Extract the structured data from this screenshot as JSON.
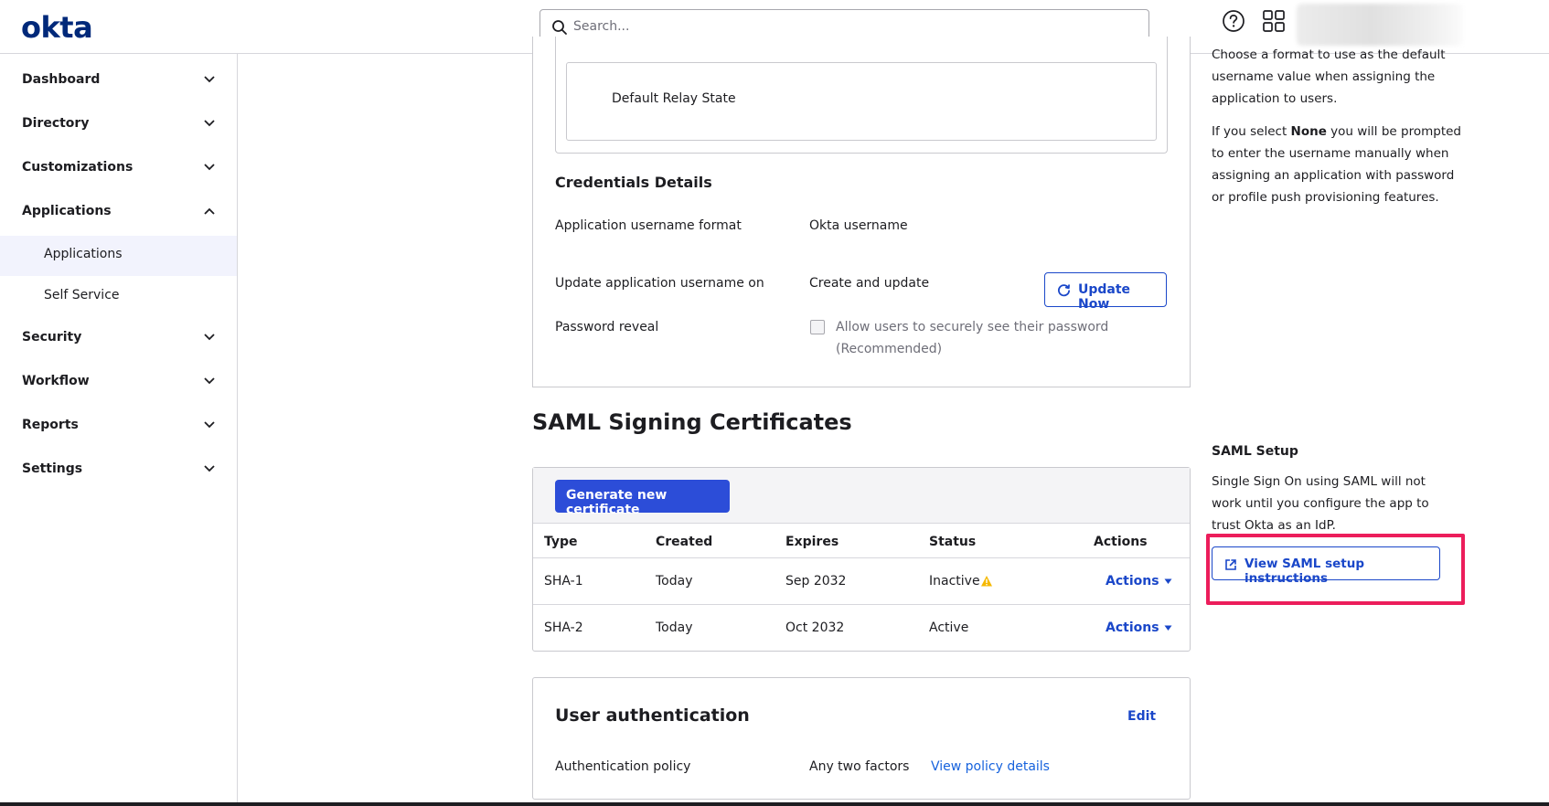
{
  "header": {
    "logo_text": "okta",
    "search": {
      "placeholder": "Search...",
      "value": ""
    }
  },
  "sidebar": {
    "items": [
      {
        "label": "Dashboard",
        "expanded": false
      },
      {
        "label": "Directory",
        "expanded": false
      },
      {
        "label": "Customizations",
        "expanded": false
      },
      {
        "label": "Applications",
        "expanded": true
      },
      {
        "label": "Security",
        "expanded": false
      },
      {
        "label": "Workflow",
        "expanded": false
      },
      {
        "label": "Reports",
        "expanded": false
      },
      {
        "label": "Settings",
        "expanded": false
      }
    ],
    "sub_items": [
      {
        "label": "Applications",
        "active": true
      },
      {
        "label": "Self Service",
        "active": false
      }
    ]
  },
  "main": {
    "relay_state_label": "Default Relay State",
    "credentials": {
      "title": "Credentials Details",
      "rows": [
        {
          "label": "Application username format",
          "value": "Okta username"
        },
        {
          "label": "Update application username on",
          "value": "Create and update"
        },
        {
          "label": "Password reveal",
          "value": ""
        }
      ],
      "update_now_label": "Update Now",
      "password_reveal_line1": "Allow users to securely see their password",
      "password_reveal_line2": "(Recommended)"
    },
    "saml_certs": {
      "title": "SAML Signing Certificates",
      "generate_label": "Generate new certificate",
      "columns": [
        "Type",
        "Created",
        "Expires",
        "Status",
        "Actions"
      ],
      "rows": [
        {
          "type": "SHA-1",
          "created": "Today",
          "expires": "Sep 2032",
          "status": "Inactive",
          "actions": "Actions"
        },
        {
          "type": "SHA-2",
          "created": "Today",
          "expires": "Oct 2032",
          "status": "Active",
          "actions": "Actions"
        }
      ]
    },
    "user_auth": {
      "title": "User authentication",
      "edit_label": "Edit",
      "policy_label": "Authentication policy",
      "policy_value": "Any two factors",
      "policy_link": "View policy details"
    }
  },
  "right": {
    "help_lines": [
      "Choose a format to use as the default",
      "username value when assigning the",
      "application to users."
    ],
    "none_pre": "If you select ",
    "none_bold": "None",
    "none_post": " you will be prompted",
    "none_lines": [
      "to enter the username manually when",
      "assigning an application with password",
      "or profile push provisioning features."
    ],
    "saml_setup": {
      "title": "SAML Setup",
      "lines": [
        "Single Sign On using SAML will not",
        "work until you configure the app to",
        "trust Okta as an IdP."
      ],
      "button_label": "View SAML setup instructions"
    }
  },
  "colors": {
    "brand": "#00297a",
    "primary": "#2c4dd8",
    "link": "#1662dd",
    "highlight": "#ec1d5b",
    "warning": "#f5b800"
  }
}
